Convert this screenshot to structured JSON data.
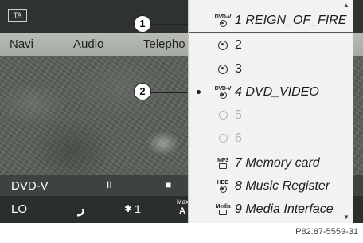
{
  "screen": {
    "ta_badge": "TA",
    "menu": [
      "Navi",
      "Audio",
      "Telepho"
    ],
    "status": {
      "source_label": "DVD-V",
      "pause_icon": "II",
      "stop_icon": "■"
    },
    "bottom": {
      "left_temp": "LO",
      "seat_icon": "ر",
      "fan_label": "1",
      "max_label": "Max",
      "auto_label": "A"
    }
  },
  "callouts": [
    "1",
    "2"
  ],
  "dropdown": {
    "items": [
      {
        "type_tag": "DVD-V",
        "label": "1 REIGN_OF_FIRE",
        "italic": true,
        "selected": true,
        "icon": "dvd-disc-icon"
      },
      {
        "type_tag": "",
        "label": "2",
        "italic": false,
        "icon": "disc-icon"
      },
      {
        "type_tag": "",
        "label": "3",
        "italic": false,
        "icon": "disc-icon"
      },
      {
        "type_tag": "DVD-V",
        "label": "4 DVD_VIDEO",
        "italic": true,
        "bullet": true,
        "icon": "dvd-disc-icon"
      },
      {
        "type_tag": "",
        "label": "5",
        "italic": false,
        "dim": true,
        "icon": "empty-slot-icon"
      },
      {
        "type_tag": "",
        "label": "6",
        "italic": false,
        "dim": true,
        "icon": "empty-slot-icon"
      },
      {
        "type_tag": "MP3",
        "label": "7 Memory card",
        "italic": true,
        "icon": "memory-card-icon"
      },
      {
        "type_tag": "HDD",
        "label": "8 Music Register",
        "italic": true,
        "icon": "hdd-icon"
      },
      {
        "type_tag": "Media",
        "label": "9 Media Interface",
        "italic": true,
        "icon": "media-interface-icon"
      }
    ],
    "scroll_up": "▲",
    "scroll_down": "▼"
  },
  "caption": "P82.87-5559-31"
}
